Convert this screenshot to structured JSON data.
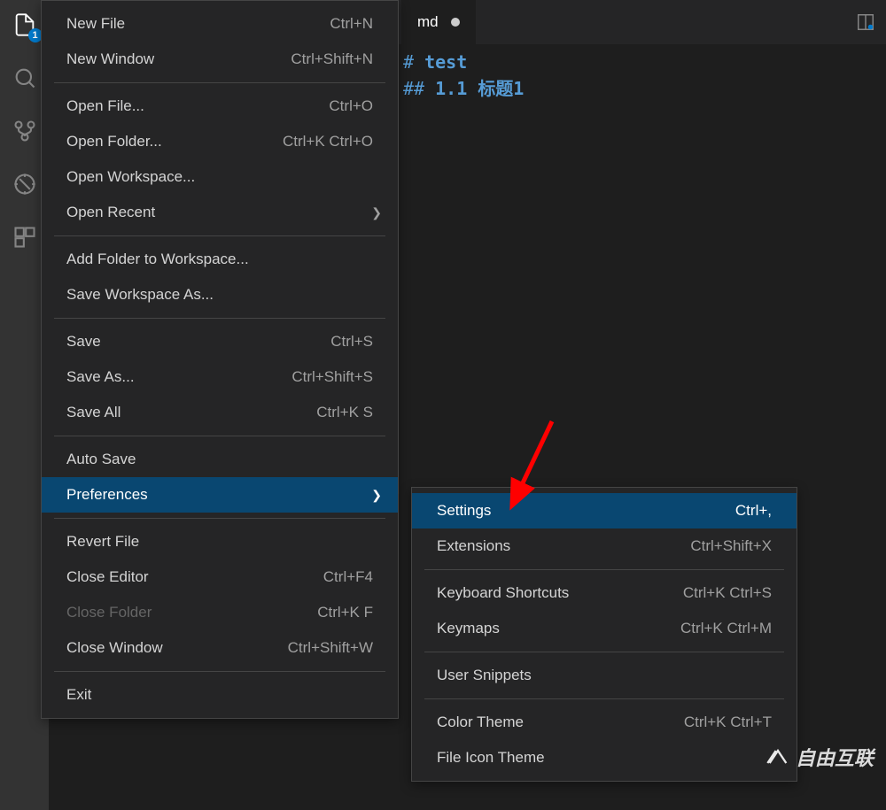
{
  "activityBar": {
    "badge": "1"
  },
  "tab": {
    "name": "md"
  },
  "editor": {
    "line1_prefix": "#",
    "line1_text": "test",
    "line2_prefix": "##",
    "line2_num": "1.1",
    "line2_text": "标题1"
  },
  "mainMenu": {
    "group1": [
      {
        "label": "New File",
        "shortcut": "Ctrl+N"
      },
      {
        "label": "New Window",
        "shortcut": "Ctrl+Shift+N"
      }
    ],
    "group2": [
      {
        "label": "Open File...",
        "shortcut": "Ctrl+O"
      },
      {
        "label": "Open Folder...",
        "shortcut": "Ctrl+K Ctrl+O"
      },
      {
        "label": "Open Workspace...",
        "shortcut": ""
      },
      {
        "label": "Open Recent",
        "shortcut": "",
        "submenu": true
      }
    ],
    "group3": [
      {
        "label": "Add Folder to Workspace...",
        "shortcut": ""
      },
      {
        "label": "Save Workspace As...",
        "shortcut": ""
      }
    ],
    "group4": [
      {
        "label": "Save",
        "shortcut": "Ctrl+S"
      },
      {
        "label": "Save As...",
        "shortcut": "Ctrl+Shift+S"
      },
      {
        "label": "Save All",
        "shortcut": "Ctrl+K S"
      }
    ],
    "group5": [
      {
        "label": "Auto Save",
        "shortcut": ""
      },
      {
        "label": "Preferences",
        "shortcut": "",
        "submenu": true,
        "hover": true
      }
    ],
    "group6": [
      {
        "label": "Revert File",
        "shortcut": ""
      },
      {
        "label": "Close Editor",
        "shortcut": "Ctrl+F4"
      },
      {
        "label": "Close Folder",
        "shortcut": "Ctrl+K F",
        "disabled": true
      },
      {
        "label": "Close Window",
        "shortcut": "Ctrl+Shift+W"
      }
    ],
    "group7": [
      {
        "label": "Exit",
        "shortcut": ""
      }
    ]
  },
  "subMenu": {
    "group1": [
      {
        "label": "Settings",
        "shortcut": "Ctrl+,",
        "hover": true
      },
      {
        "label": "Extensions",
        "shortcut": "Ctrl+Shift+X"
      }
    ],
    "group2": [
      {
        "label": "Keyboard Shortcuts",
        "shortcut": "Ctrl+K Ctrl+S"
      },
      {
        "label": "Keymaps",
        "shortcut": "Ctrl+K Ctrl+M"
      }
    ],
    "group3": [
      {
        "label": "User Snippets",
        "shortcut": ""
      }
    ],
    "group4": [
      {
        "label": "Color Theme",
        "shortcut": "Ctrl+K Ctrl+T"
      },
      {
        "label": "File Icon Theme",
        "shortcut": ""
      }
    ]
  },
  "watermark": "自由互联"
}
